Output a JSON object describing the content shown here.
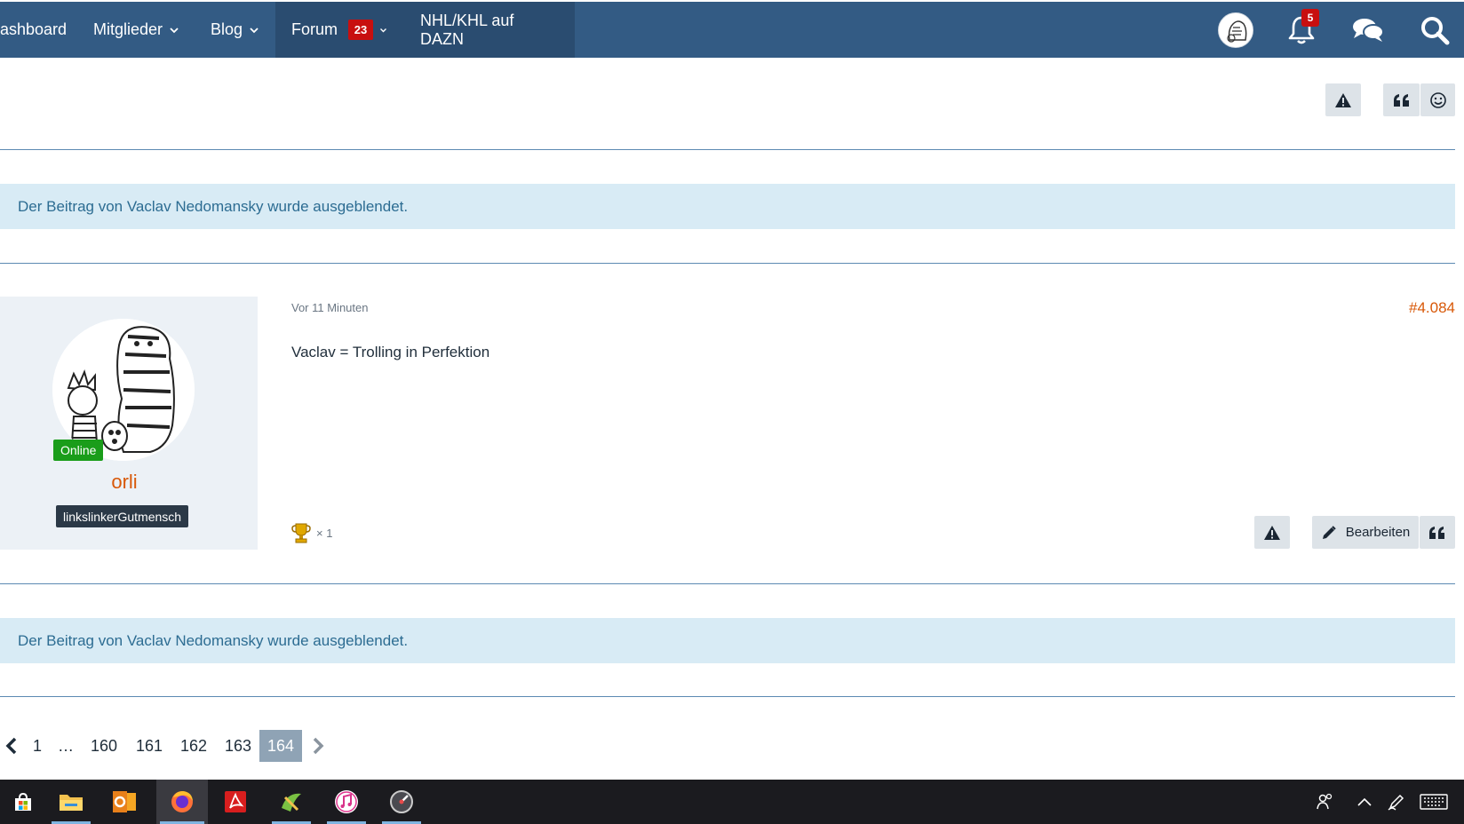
{
  "nav": {
    "items": [
      {
        "label": "ashboard"
      },
      {
        "label": "Mitglieder"
      },
      {
        "label": "Blog"
      },
      {
        "label": "Forum",
        "badge": "23"
      },
      {
        "label": "NHL/KHL auf DAZN"
      }
    ],
    "notifications_count": "5",
    "icons": [
      "user-avatar-icon",
      "bell-icon",
      "conversations-icon",
      "search-icon"
    ]
  },
  "notices": {
    "hidden_1": "Der Beitrag von Vaclav Nedomansky wurde ausgeblendet.",
    "hidden_2": "Der Beitrag von Vaclav Nedomansky wurde ausgeblendet."
  },
  "post": {
    "user": {
      "status": "Online",
      "name": "orli",
      "title": "linkslinkerGutmensch"
    },
    "time": "Vor 11 Minuten",
    "number": "#4.084",
    "body": "Vaclav = Trolling in Perfektion",
    "trophy_count": "× 1",
    "edit_label": "Bearbeiten"
  },
  "pagination": {
    "pages": [
      "1",
      "…",
      "160",
      "161",
      "162",
      "163"
    ],
    "current": "164"
  },
  "colors": {
    "nav": "#335b84",
    "accent": "#d85808",
    "notice_bg": "#d8ebf5",
    "online": "#1a9d1a",
    "badge": "#c80f0f"
  }
}
